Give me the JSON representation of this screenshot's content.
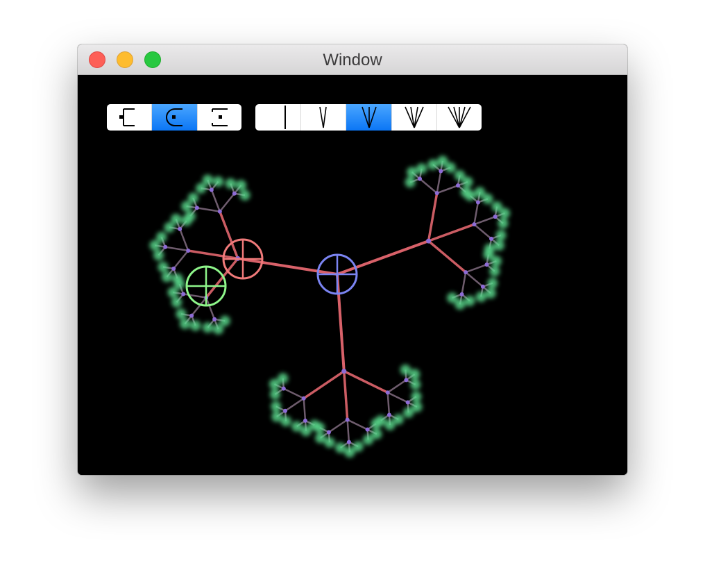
{
  "window": {
    "title": "Window"
  },
  "toolbar": {
    "layout_segments": [
      {
        "icon": "left-bracket-node-icon",
        "selected": false
      },
      {
        "icon": "radial-node-icon",
        "selected": true
      },
      {
        "icon": "boxed-node-icon",
        "selected": false
      }
    ],
    "branching_segments": [
      {
        "icon": "one-branch-icon",
        "selected": false
      },
      {
        "icon": "two-branches-icon",
        "selected": false
      },
      {
        "icon": "three-branches-icon",
        "selected": true
      },
      {
        "icon": "four-branches-icon",
        "selected": false
      },
      {
        "icon": "five-branches-icon",
        "selected": false
      }
    ]
  },
  "colors": {
    "selection_accent": "#1183fa",
    "canvas_background": "#000000",
    "root_target": "#7b84f2",
    "secondary_target": "#f07a7a",
    "tertiary_target": "#8ef58a",
    "leaf_glow": "#59d98c",
    "node_dot": "#8d6bd6",
    "edge_strong": "#ef6c74"
  },
  "scene": {
    "branching_factor": 3,
    "depth": 4,
    "targets": [
      "root-target-icon",
      "secondary-target-icon",
      "tertiary-target-icon"
    ]
  }
}
